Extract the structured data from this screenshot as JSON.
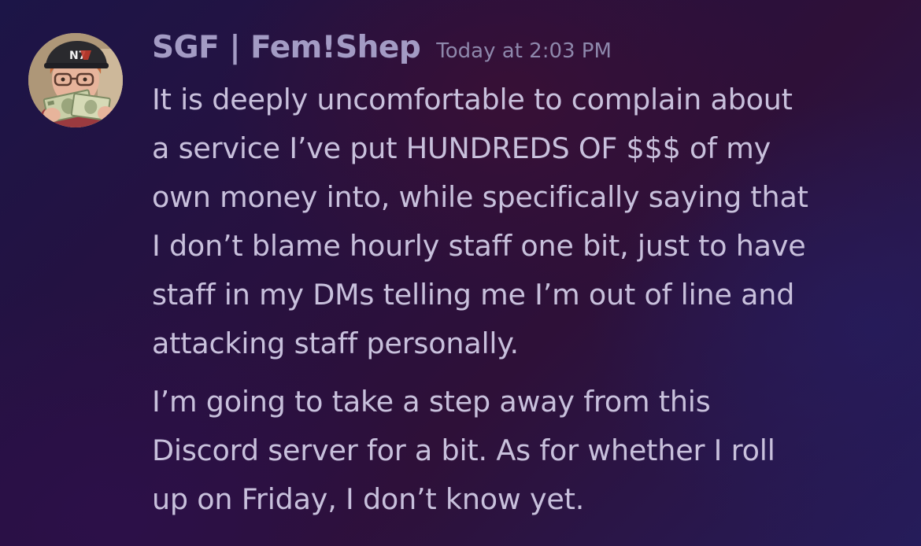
{
  "message": {
    "author": "SGF | Fem!Shep",
    "timestamp": "Today at 2:03 PM",
    "avatar_badge": "N7",
    "paragraphs": [
      {
        "lines": [
          "It is deeply uncomfortable to complain about",
          "a service I’ve put HUNDREDS OF $$$ of my",
          "own money into, while specifically saying that",
          "I don’t blame hourly staff one bit, just to have",
          "staff in my DMs telling me I’m out of line and",
          "attacking staff personally."
        ]
      },
      {
        "lines": [
          "I’m going to take a step away from this",
          "Discord server for a bit. As for whether I roll",
          "up on Friday, I don’t know yet."
        ]
      }
    ]
  },
  "colors": {
    "username": "#a39bc4",
    "timestamp": "#8e88ac",
    "message_text": "#c8c0dc"
  }
}
